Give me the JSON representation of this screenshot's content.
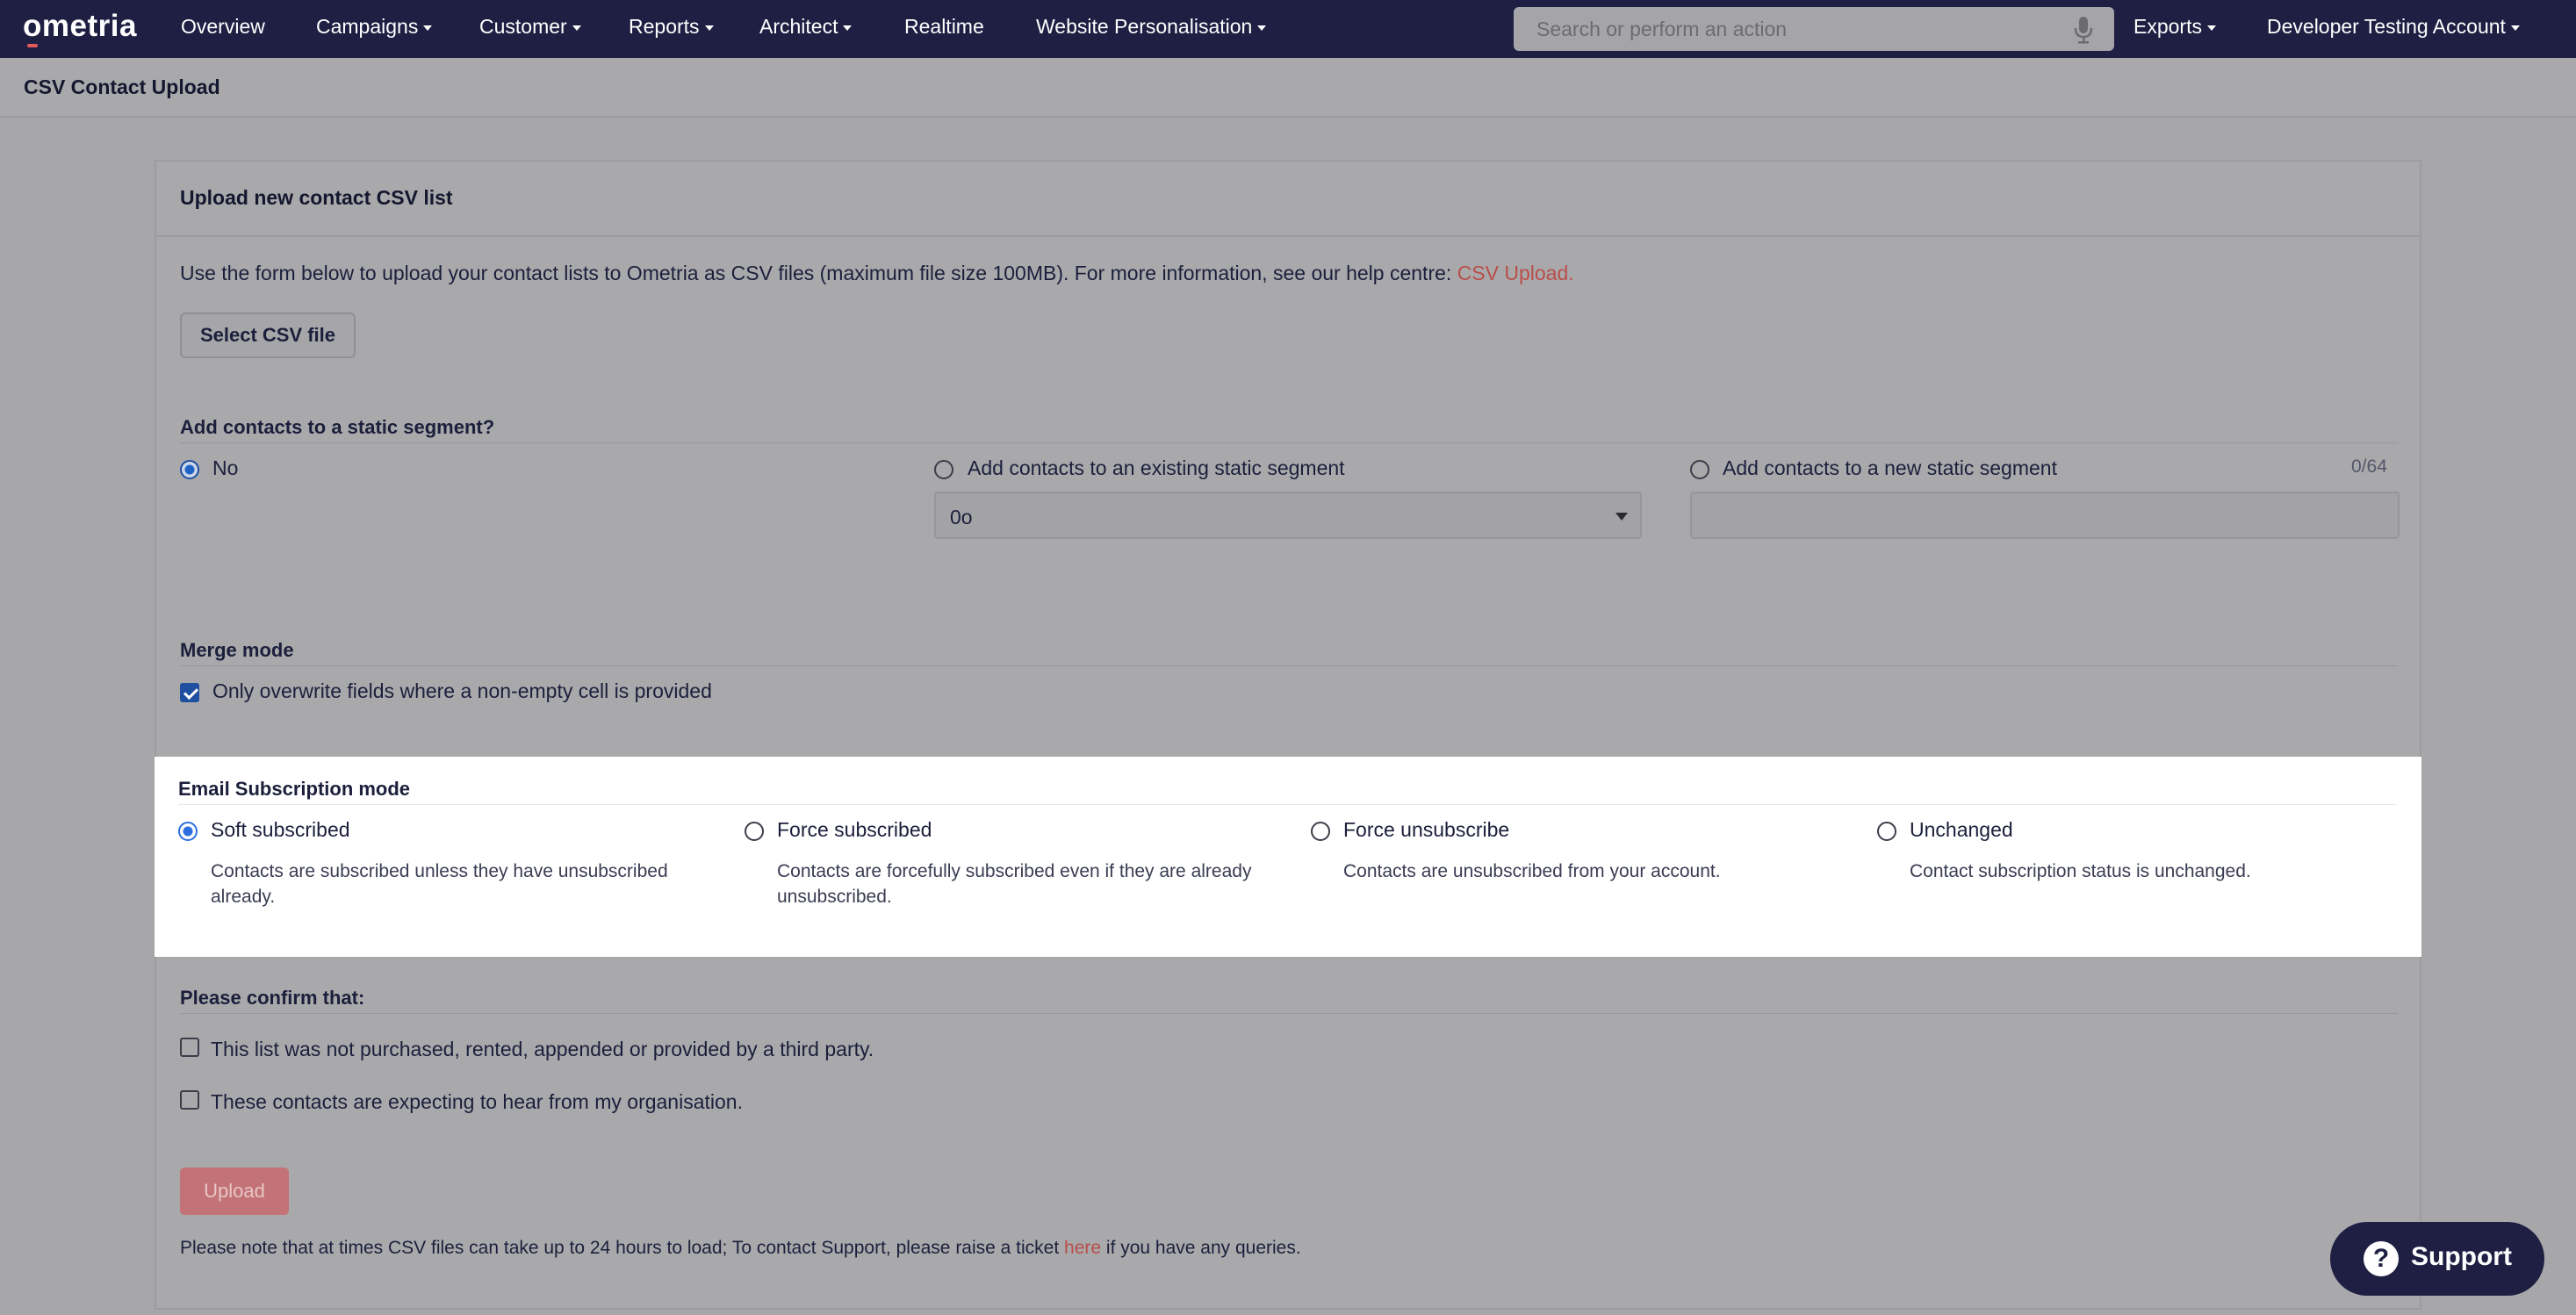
{
  "nav": {
    "logo": "ometria",
    "items": [
      {
        "label": "Overview",
        "caret": false
      },
      {
        "label": "Campaigns",
        "caret": true
      },
      {
        "label": "Customer",
        "caret": true
      },
      {
        "label": "Reports",
        "caret": true
      },
      {
        "label": "Architect",
        "caret": true
      },
      {
        "label": "Realtime",
        "caret": false
      },
      {
        "label": "Website Personalisation",
        "caret": true
      }
    ],
    "search_placeholder": "Search or perform an action",
    "exports": "Exports",
    "account": "Developer Testing Account"
  },
  "page": {
    "title": "CSV Contact Upload"
  },
  "card": {
    "header": "Upload new contact CSV list",
    "intro": "Use the form below to upload your contact lists to Ometria as CSV files (maximum file size 100MB). For more information, see our help centre: ",
    "intro_link": "CSV Upload.",
    "select_file_label": "Select CSV file"
  },
  "segment": {
    "heading": "Add contacts to a static segment?",
    "option_no": "No",
    "option_existing": "Add contacts to an existing static segment",
    "option_new": "Add contacts to a new static segment",
    "counter": "0/64",
    "selected_segment": "0o",
    "new_segment_value": ""
  },
  "merge": {
    "heading": "Merge mode",
    "option": "Only overwrite fields where a non-empty cell is provided",
    "checked": true
  },
  "subscription": {
    "heading": "Email Subscription mode",
    "options": [
      {
        "label": "Soft subscribed",
        "desc": "Contacts are subscribed unless they have unsubscribed already.",
        "selected": true
      },
      {
        "label": "Force subscribed",
        "desc": "Contacts are forcefully subscribed even if they are already unsubscribed.",
        "selected": false
      },
      {
        "label": "Force unsubscribe",
        "desc": "Contacts are unsubscribed from your account.",
        "selected": false
      },
      {
        "label": "Unchanged",
        "desc": "Contact subscription status is unchanged.",
        "selected": false
      }
    ]
  },
  "confirm": {
    "heading": "Please confirm that:",
    "item1": "This list was not purchased, rented, appended or provided by a third party.",
    "item2": "These contacts are expecting to hear from my organisation."
  },
  "upload_label": "Upload",
  "footnote": {
    "text_before": "Please note that at times CSV files can take up to 24 hours to load; To contact Support, please raise a ticket ",
    "link": "here",
    "text_after": " if you have any queries."
  },
  "support_label": "Support",
  "colors": {
    "nav_bg": "#1e1f43",
    "accent_link": "#b94e4a",
    "radio_selected": "#2b6fe0"
  }
}
